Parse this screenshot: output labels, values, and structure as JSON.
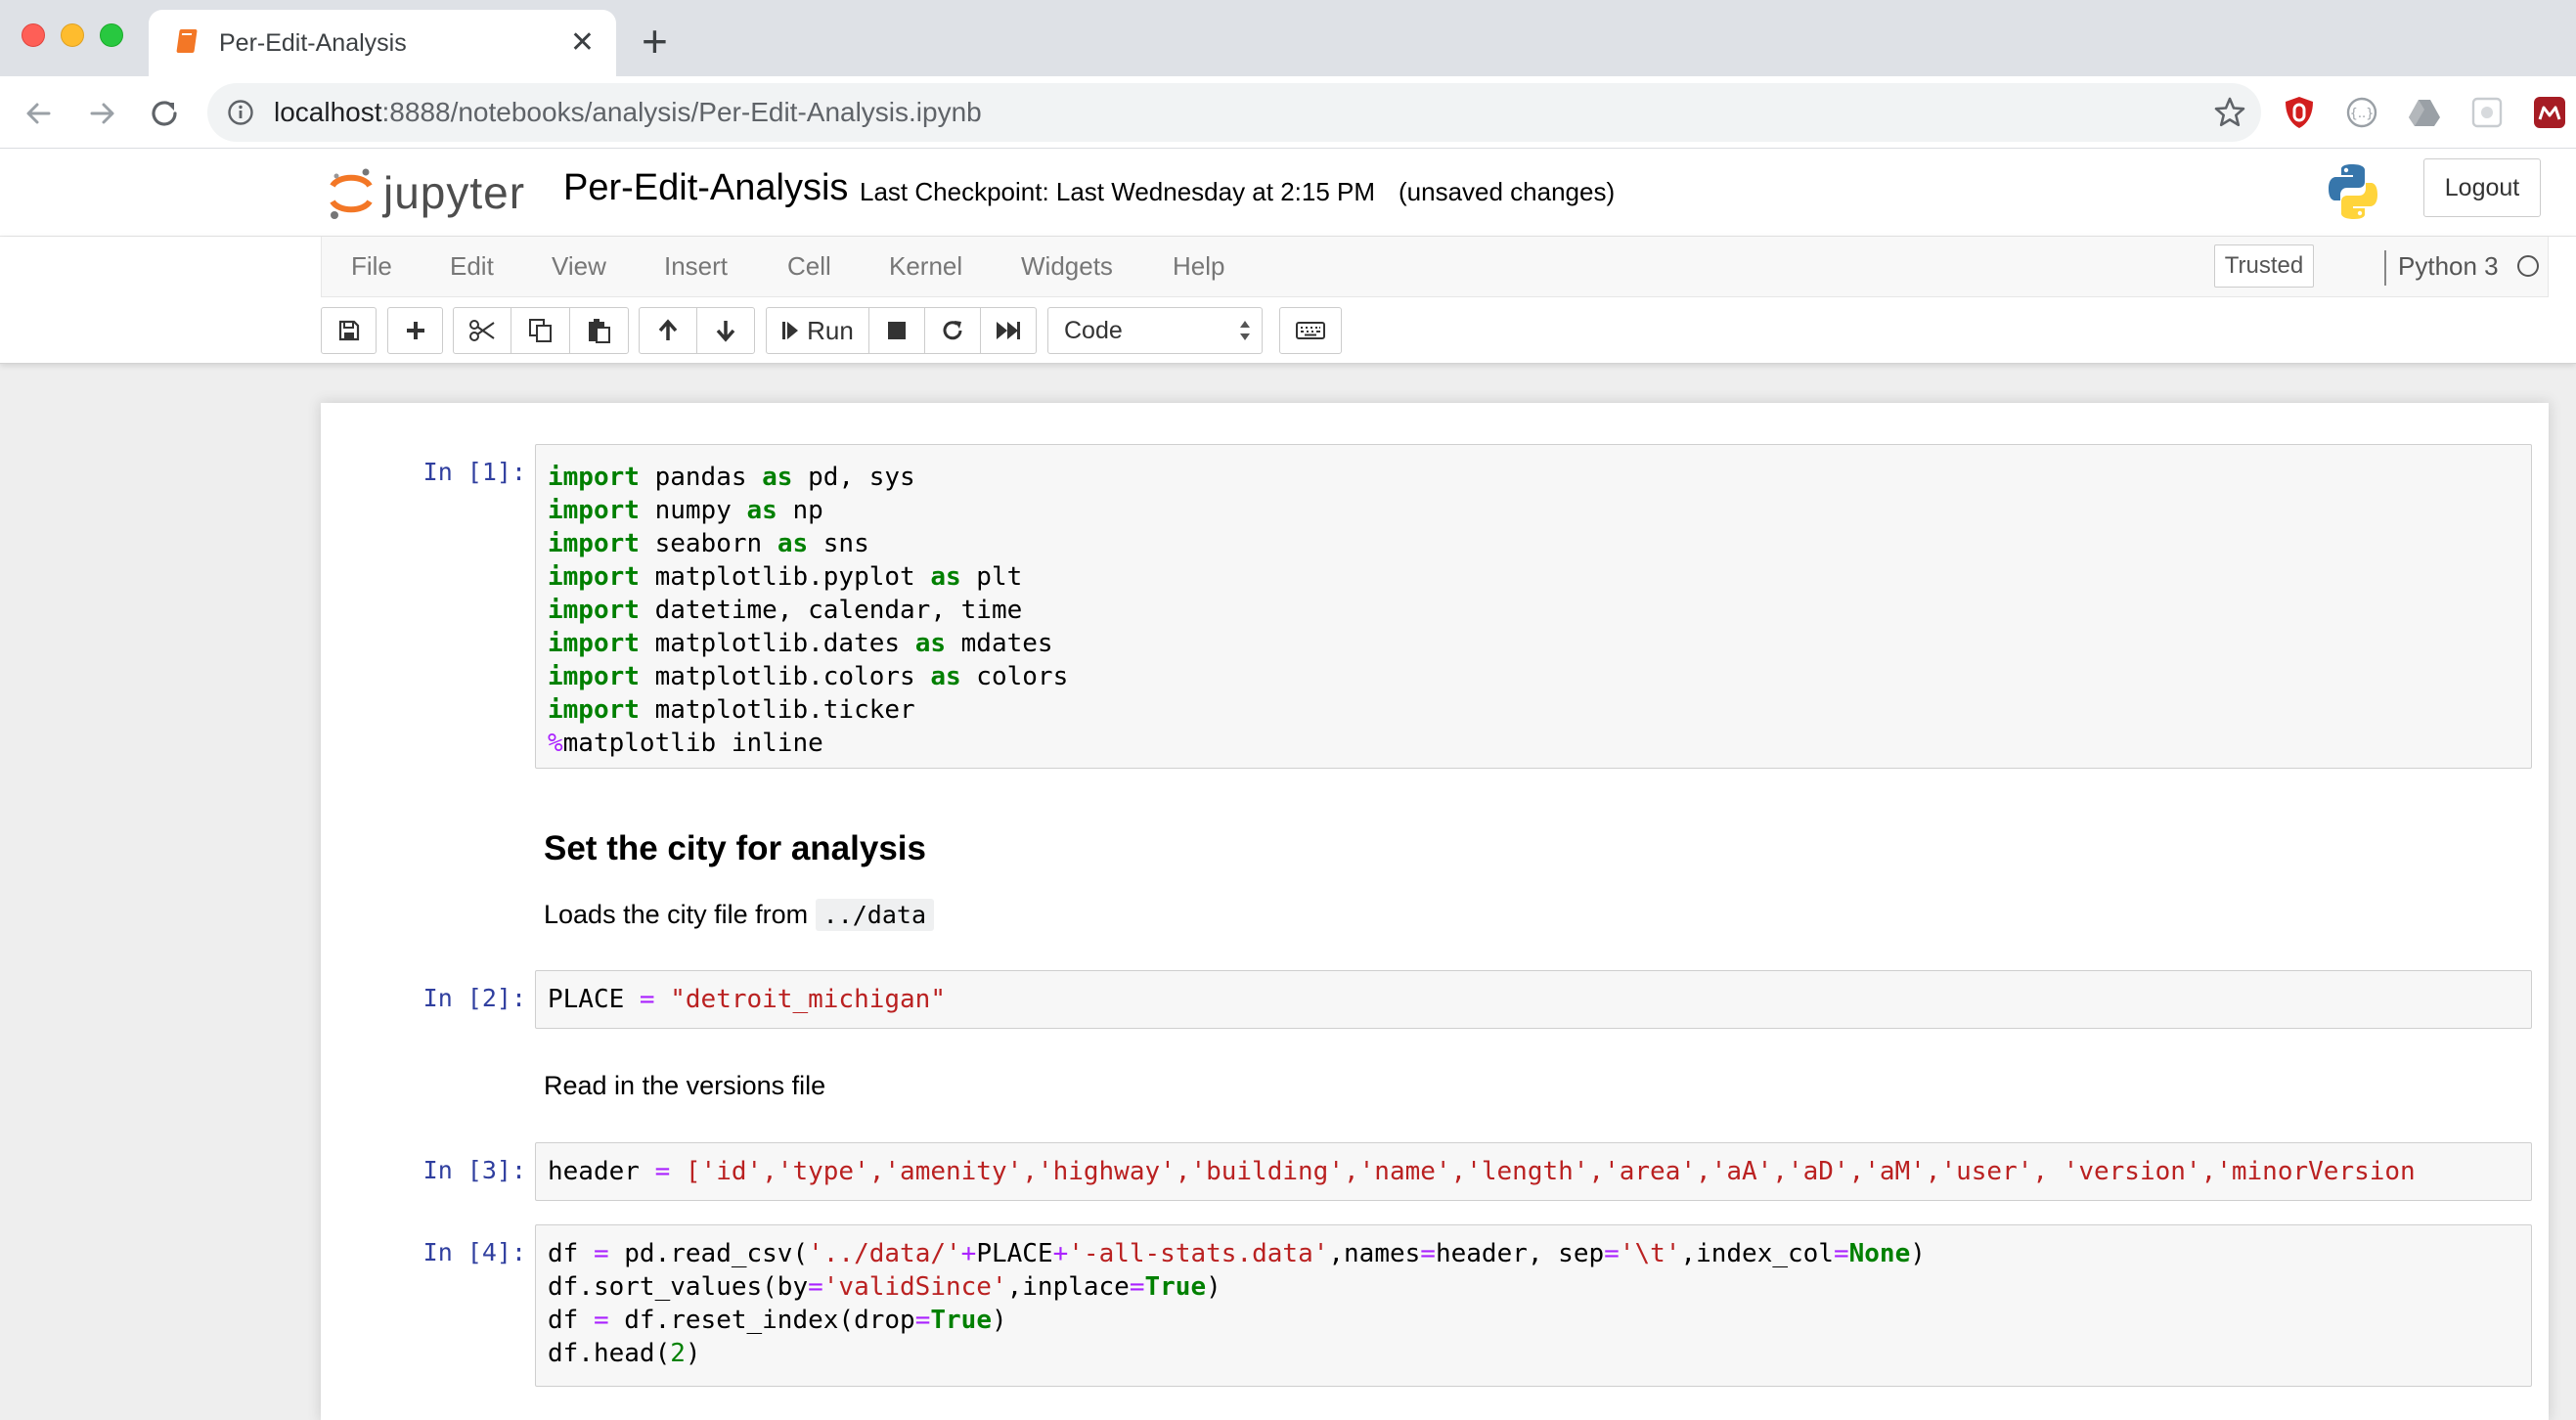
{
  "browser": {
    "tab_title": "Per-Edit-Analysis",
    "url_host": "localhost",
    "url_rest": ":8888/notebooks/analysis/Per-Edit-Analysis.ipynb",
    "icons": [
      "back-icon",
      "forward-icon",
      "reload-icon",
      "info-icon",
      "star-icon",
      "ublock-icon",
      "extension-icon",
      "drive-icon",
      "extension-icon",
      "profile-icon"
    ]
  },
  "jupyter": {
    "logo_text": "jupyter",
    "notebook_title": "Per-Edit-Analysis",
    "checkpoint": "Last Checkpoint: Last Wednesday at 2:15 PM",
    "unsaved": "(unsaved changes)",
    "logout_label": "Logout"
  },
  "menubar": {
    "items": [
      "File",
      "Edit",
      "View",
      "Insert",
      "Cell",
      "Kernel",
      "Widgets",
      "Help"
    ],
    "trusted_label": "Trusted",
    "kernel_name": "Python 3"
  },
  "toolbar": {
    "run_label": "Run",
    "cell_type": "Code"
  },
  "cells": {
    "c1": {
      "prompt": "In [1]:",
      "lines": [
        {
          "a": "import",
          "b": " pandas ",
          "c": "as",
          "d": " pd, sys"
        },
        {
          "a": "import",
          "b": " numpy ",
          "c": "as",
          "d": " np"
        },
        {
          "a": "import",
          "b": " seaborn ",
          "c": "as",
          "d": " sns"
        },
        {
          "a": "import",
          "b": " matplotlib.pyplot ",
          "c": "as",
          "d": " plt"
        },
        {
          "a": "import",
          "b": " datetime, calendar, time"
        },
        {
          "a": "import",
          "b": " matplotlib.dates ",
          "c": "as",
          "d": " mdates"
        },
        {
          "a": "import",
          "b": " matplotlib.colors ",
          "c": "as",
          "d": " colors"
        },
        {
          "a": "import",
          "b": " matplotlib.ticker"
        }
      ],
      "magic_op": "%",
      "magic_rest": "matplotlib inline"
    },
    "md1": {
      "heading": "Set the city for analysis",
      "text": "Loads the city file from",
      "code": "../data"
    },
    "c2": {
      "prompt": "In [2]:",
      "var": "PLACE ",
      "op": "=",
      "str": " \"detroit_michigan\""
    },
    "md2": {
      "text": "Read in the versions file"
    },
    "c3": {
      "prompt": "In [3]:",
      "var": "header ",
      "op": "=",
      "rest": " ['id','type','amenity','highway','building','name','length','area','aA','aD','aM','user', 'version','minorVersion"
    },
    "c4": {
      "prompt": "In [4]:",
      "l1": {
        "a": "df ",
        "b": "=",
        "c": " pd.read_csv(",
        "d": "'../data/'",
        "e": "+",
        "f": "PLACE",
        "g": "+",
        "h": "'-all-stats.data'",
        "i": ",names",
        "j": "=",
        "k": "header, sep",
        "l": "=",
        "m": "'\\t'",
        "n": ",index_col",
        "o": "=",
        "p": "None",
        "q": ")"
      },
      "l2": {
        "a": "df.sort_values(by",
        "b": "=",
        "c": "'validSince'",
        "d": ",inplace",
        "e": "=",
        "f": "True",
        "g": ")"
      },
      "l3": {
        "a": "df ",
        "b": "=",
        "c": " df.reset_index(drop",
        "d": "=",
        "e": "True",
        "f": ")"
      },
      "l4": {
        "a": "df.head(",
        "b": "2",
        "c": ")"
      }
    }
  }
}
